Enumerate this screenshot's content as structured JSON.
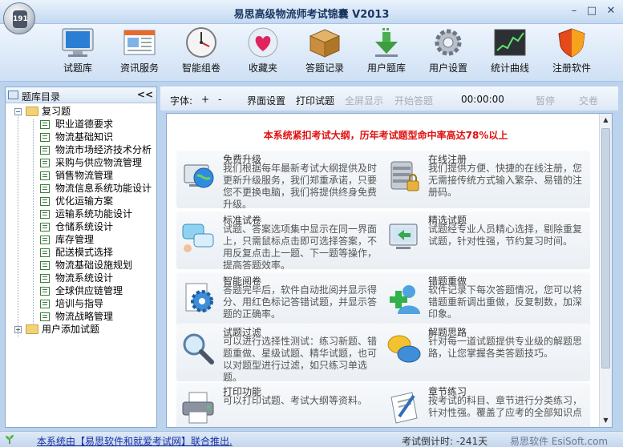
{
  "window": {
    "title": "易思高级物流师考试锦囊 V2013",
    "minimize": "–",
    "maximize": "□",
    "close": "✕"
  },
  "toolbar": {
    "items": [
      {
        "label": "试题库",
        "icon": "monitor-icon"
      },
      {
        "label": "资讯服务",
        "icon": "news-window-icon"
      },
      {
        "label": "智能组卷",
        "icon": "clock-icon"
      },
      {
        "label": "收藏夹",
        "icon": "heart-icon"
      },
      {
        "label": "答题记录",
        "icon": "box-icon"
      },
      {
        "label": "用户题库",
        "icon": "download-arrow-icon"
      },
      {
        "label": "用户设置",
        "icon": "gear-icon"
      },
      {
        "label": "统计曲线",
        "icon": "chart-icon"
      },
      {
        "label": "注册软件",
        "icon": "shield-icon"
      }
    ]
  },
  "left_pane": {
    "title": "题库目录",
    "collapse": "<<",
    "tree": {
      "root1": {
        "label": "复习题",
        "expander": "−"
      },
      "children": [
        "职业道德要求",
        "物流基础知识",
        "物流市场经济技术分析",
        "采购与供应物流管理",
        "销售物流管理",
        "物流信息系统功能设计",
        "优化运输方案",
        "运输系统功能设计",
        "仓储系统设计",
        "库存管理",
        "配送模式选择",
        "物流基础设施规划",
        "物流系统设计",
        "全球供应链管理",
        "培训与指导",
        "物流战略管理"
      ],
      "root2": {
        "label": "用户添加试题",
        "expander": "+"
      }
    }
  },
  "right_toolbar": {
    "font_label": "字体:",
    "font_plus": "+",
    "font_minus": "-",
    "ui_settings": "界面设置",
    "print_questions": "打印试题",
    "fullscreen": "全屏显示",
    "start_answer": "开始答题",
    "timer": "00:00:00",
    "pause": "暂停",
    "submit": "交卷"
  },
  "content": {
    "banner": "本系统紧扣考试大纲，历年考试题型命中率高达78%以上",
    "features": [
      {
        "name": "免费升级",
        "desc": "我们根据每年最新考试大纲提供及时更新升级服务，我们郑重承诺，只要您不更换电脑，我们将提供终身免费升级。",
        "icon": "globe-computer-icon"
      },
      {
        "name": "在线注册",
        "desc": "我们提供方便、快捷的在线注册，您无需接传统方式输入繁杂、易错的注册码。",
        "icon": "database-lock-icon"
      },
      {
        "name": "标准试卷",
        "desc": "试题、答案选项集中显示在同一界面上，只需鼠标点击即可选择答案，不用反复点击上一题、下一题等操作，提高答题效率。",
        "icon": "chat-bubbles-icon"
      },
      {
        "name": "精选试题",
        "desc": "试题经专业人员精心选择，剔除重复试题，针对性强，节约复习时间。",
        "icon": "monitor-refresh-icon"
      },
      {
        "name": "智能阅卷",
        "desc": "答题完毕后，软件自动批阅并显示得分、用红色标记答错试题，并显示答题的正确率。",
        "icon": "gear-document-icon"
      },
      {
        "name": "错题重做",
        "desc": "软件记录下每次答题情况，您可以将错题重新调出重做，反复制数，加深印象。",
        "icon": "green-plus-icon"
      },
      {
        "name": "试题过滤",
        "desc": "可以进行选择性测试：练习新题、错题重做、星级试题、精华试题，也可以对题型进行过滤，如只练习单选题。",
        "icon": "magnifier-icon"
      },
      {
        "name": "解题思路",
        "desc": "针对每一道试题提供专业级的解题思路，让您掌握各类答题技巧。",
        "icon": "chat-yellow-icon"
      },
      {
        "name": "打印功能",
        "desc": "可以打印试题、考试大纲等资料。",
        "icon": "printer-icon"
      },
      {
        "name": "章节练习",
        "desc": "按考试的科目、章节进行分类练习，针对性强。覆盖了应考的全部知识点",
        "icon": "pen-document-icon"
      }
    ]
  },
  "status_bar": {
    "credit": "本系统由【易思软件和就爱考试网】联合推出.",
    "countdown": "考试倒计时: -241天",
    "brand": "易思软件 EsiSoft.com"
  },
  "colors": {
    "banner_red": "#e01010",
    "frame_blue": "#8aa8cf",
    "toolbar_bg": "#cfe0f4"
  }
}
